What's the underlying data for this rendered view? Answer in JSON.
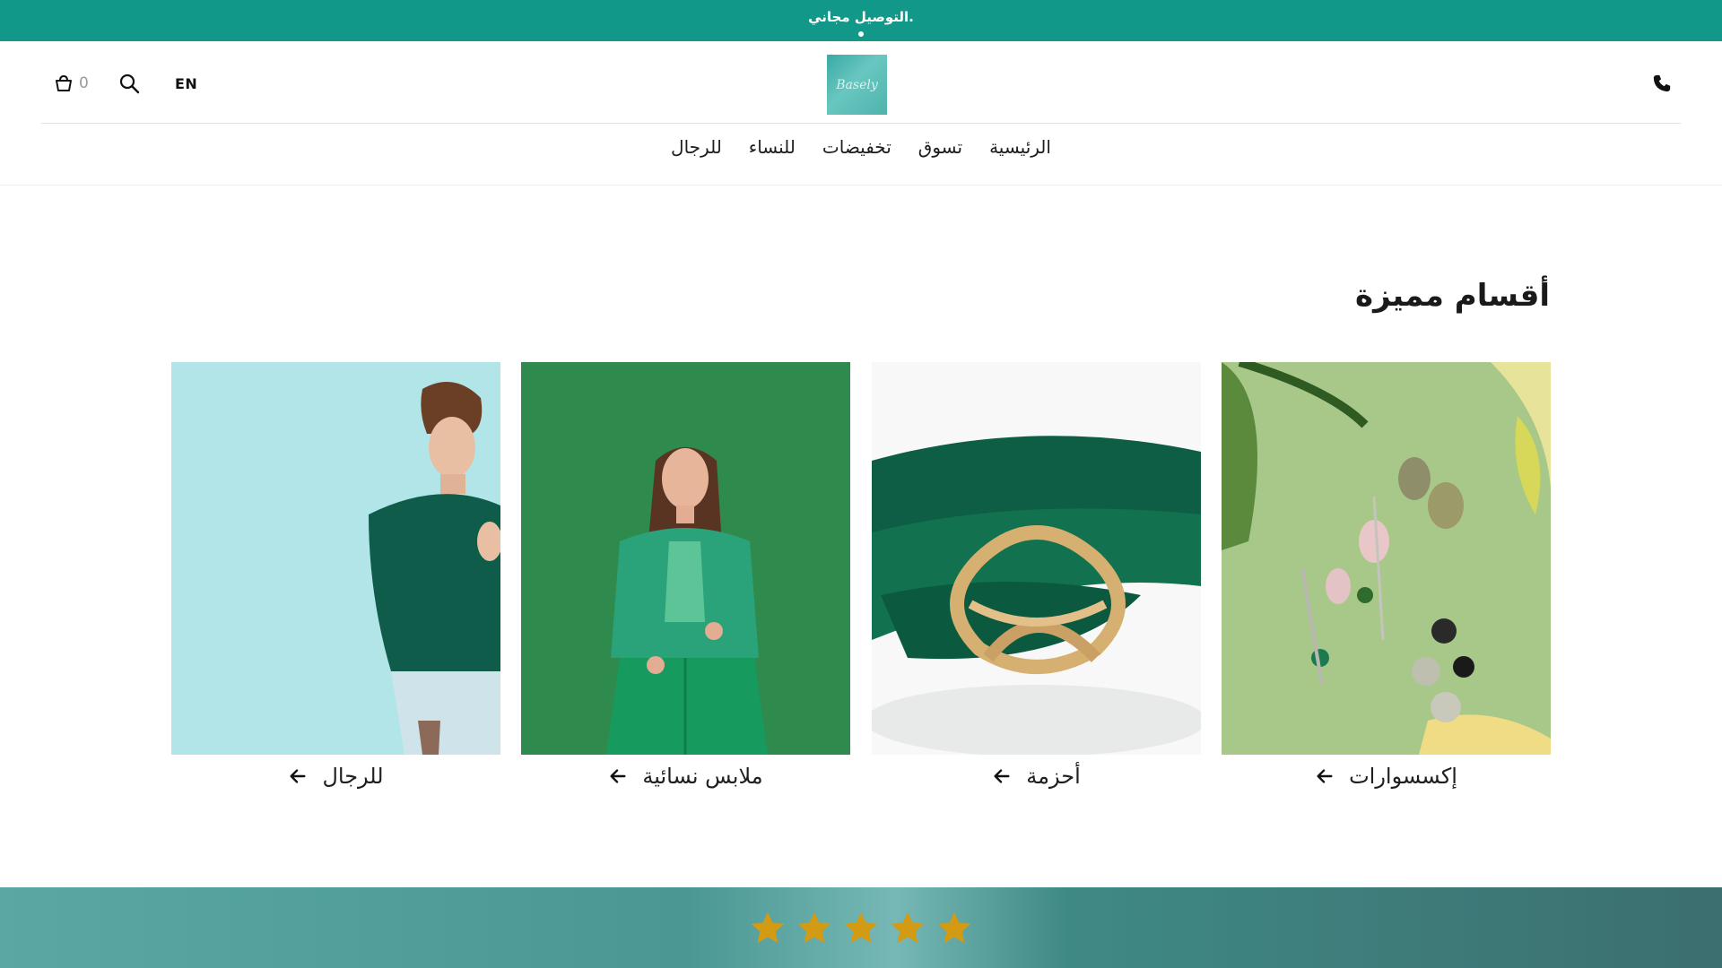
{
  "announcement": {
    "text": ".التوصيل مجاني"
  },
  "header": {
    "cart_count": "0",
    "language": "EN",
    "logo_text": "Basely"
  },
  "nav": {
    "items": [
      {
        "label": "الرئيسية"
      },
      {
        "label": "تسوق"
      },
      {
        "label": "تخفيضات"
      },
      {
        "label": "للنساء"
      },
      {
        "label": "للرجال"
      }
    ]
  },
  "featured": {
    "title": "أقسام مميزة",
    "cards": [
      {
        "label": "إكسسوارات"
      },
      {
        "label": "أحزمة"
      },
      {
        "label": "ملابس نسائية"
      },
      {
        "label": "للرجال"
      }
    ]
  },
  "reviews": {
    "rating": 5,
    "max_rating": 5
  },
  "colors": {
    "accent": "#129888",
    "star": "#d39a14"
  }
}
